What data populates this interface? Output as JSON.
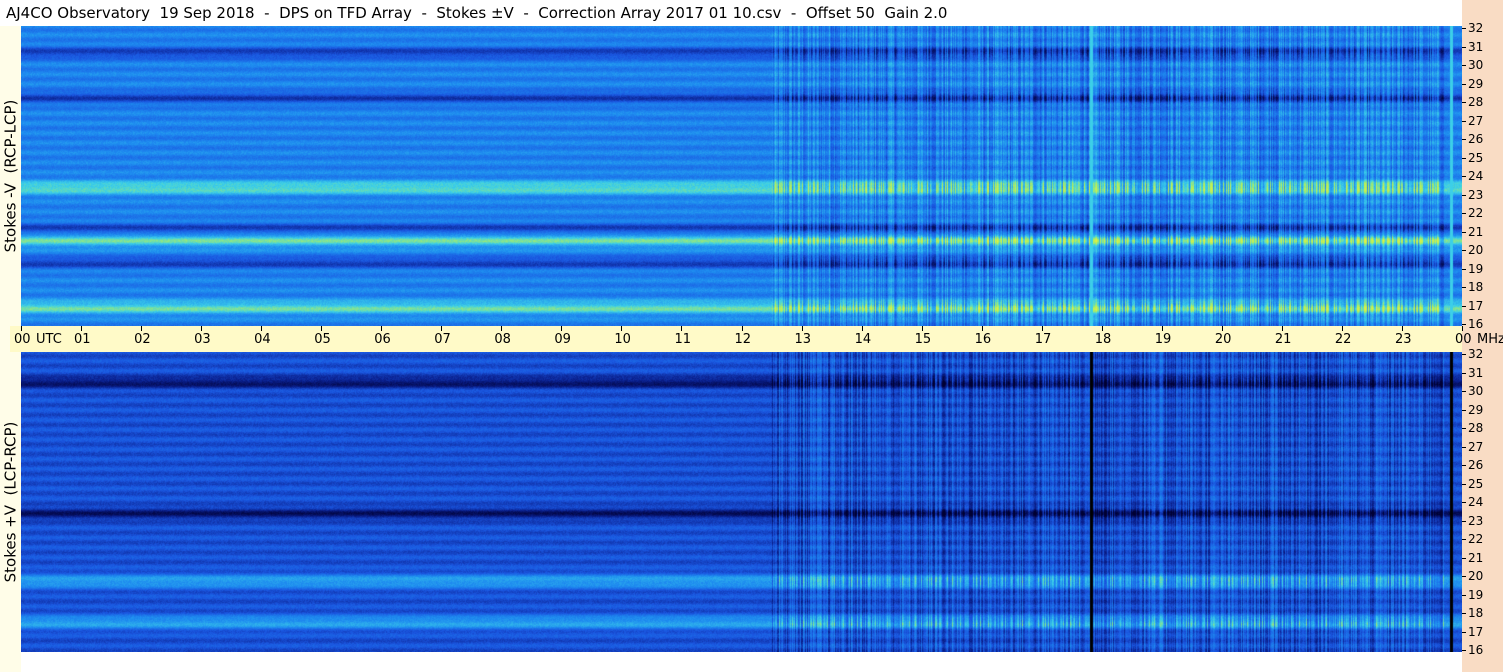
{
  "title": "AJ4CO Observatory  19 Sep 2018  -  DPS on TFD Array  -  Stokes ±V  -  Correction Array 2017 01 10.csv  -  Offset 50  Gain 2.0",
  "colors": {
    "background": "#ffffff",
    "time_axis_band": "#fffac8",
    "freq_axis_band": "#f9dcc4",
    "colormap": [
      "#000033",
      "#0a1f8c",
      "#1a56e0",
      "#1e8cf0",
      "#3ccfe8",
      "#b4f05a",
      "#f0f03c",
      "#f06464"
    ]
  },
  "chart_data": [
    {
      "type": "heatmap",
      "name": "Stokes -V panel",
      "ylabel": "Stokes -V  (RCP-LCP)",
      "xlabel": "UTC",
      "x_unit": "UTC",
      "y_unit": "MHz",
      "x_range": [
        0,
        24
      ],
      "y_range": [
        16,
        32
      ],
      "x_tick_labels": [
        "00",
        "01",
        "02",
        "03",
        "04",
        "05",
        "06",
        "07",
        "08",
        "09",
        "10",
        "11",
        "12",
        "13",
        "14",
        "15",
        "16",
        "17",
        "18",
        "19",
        "20",
        "21",
        "22",
        "23",
        "00"
      ],
      "y_tick_labels": [
        "32",
        "31",
        "30",
        "29",
        "28",
        "27",
        "26",
        "25",
        "24",
        "23",
        "22",
        "21",
        "20",
        "19",
        "18",
        "17",
        "16"
      ],
      "bright_bands_MHz": [
        17.0,
        20.6,
        23.4
      ],
      "dark_bands_MHz": [
        19.4,
        21.2,
        28.2,
        30.6
      ],
      "notable_vertical_lines_UTC": [
        17.8,
        23.8
      ]
    },
    {
      "type": "heatmap",
      "name": "Stokes +V panel",
      "ylabel": "Stokes +V  (LCP-RCP)",
      "xlabel": "UTC",
      "x_unit": "UTC",
      "y_unit": "MHz",
      "x_range": [
        0,
        24
      ],
      "y_range": [
        16,
        32
      ],
      "y_tick_labels": [
        "32",
        "31",
        "30",
        "29",
        "28",
        "27",
        "26",
        "25",
        "24",
        "23",
        "22",
        "21",
        "20",
        "19",
        "18",
        "17",
        "16"
      ],
      "bright_bands_MHz": [
        17.6,
        19.8
      ],
      "dark_bands_MHz": [
        23.4,
        30.4
      ],
      "notable_vertical_lines_UTC": [
        17.8,
        23.8
      ]
    }
  ],
  "axis": {
    "time_ticks": [
      "00",
      "01",
      "02",
      "03",
      "04",
      "05",
      "06",
      "07",
      "08",
      "09",
      "10",
      "11",
      "12",
      "13",
      "14",
      "15",
      "16",
      "17",
      "18",
      "19",
      "20",
      "21",
      "22",
      "23",
      "00"
    ],
    "time_unit_label": "UTC",
    "freq_unit_label": "MHz"
  }
}
